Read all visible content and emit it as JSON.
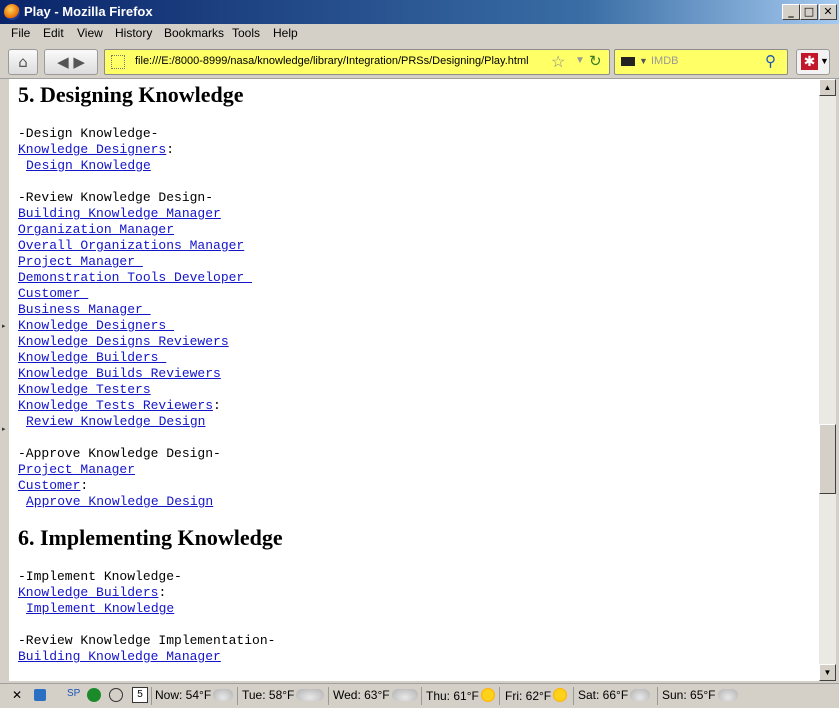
{
  "window": {
    "title": "Play - Mozilla Firefox",
    "min": "_",
    "max": "□",
    "close": "✕"
  },
  "menu": [
    "File",
    "Edit",
    "View",
    "History",
    "Bookmarks",
    "Tools",
    "Help"
  ],
  "nav": {
    "url": "file:///E:/8000-8999/nasa/knowledge/library/Integration/PRSs/Designing/Play.html",
    "search_placeholder": "IMDB"
  },
  "doc": {
    "s5": "5. Designing Knowledge",
    "design_head": "-Design Knowledge-",
    "design_role": "Knowledge Designers",
    "design_btn": "Design Knowledge",
    "review_head": "-Review Knowledge Design-",
    "review_roles": [
      "Building Knowledge Manager",
      "Organization Manager",
      "Overall Organizations Manager",
      "Project Manager ",
      "Demonstration Tools Developer ",
      "Customer ",
      "Business Manager ",
      "Knowledge Designers ",
      "Knowledge Designs Reviewers",
      "Knowledge Builders ",
      "Knowledge Builds Reviewers",
      "Knowledge Testers",
      "Knowledge Tests Reviewers"
    ],
    "review_btn": "Review Knowledge Design",
    "approve_head": "-Approve Knowledge Design-",
    "approve_roles": [
      "Project Manager",
      "Customer"
    ],
    "approve_btn": "Approve Knowledge Design",
    "s6": "6. Implementing Knowledge",
    "impl_head": "-Implement Knowledge-",
    "impl_role": "Knowledge Builders",
    "impl_btn": "Implement Knowledge",
    "rimpl_head": "-Review Knowledge Implementation-",
    "rimpl_role": "Building Knowledge Manager",
    "colon": ":"
  },
  "status": {
    "close": "✕",
    "sp": "SP",
    "cal_day": "5",
    "weather": [
      "Now: 54°F",
      "Tue: 58°F",
      "Wed: 63°F",
      "Thu: 61°F",
      "Fri: 62°F",
      "Sat: 66°F",
      "Sun: 65°F"
    ]
  }
}
